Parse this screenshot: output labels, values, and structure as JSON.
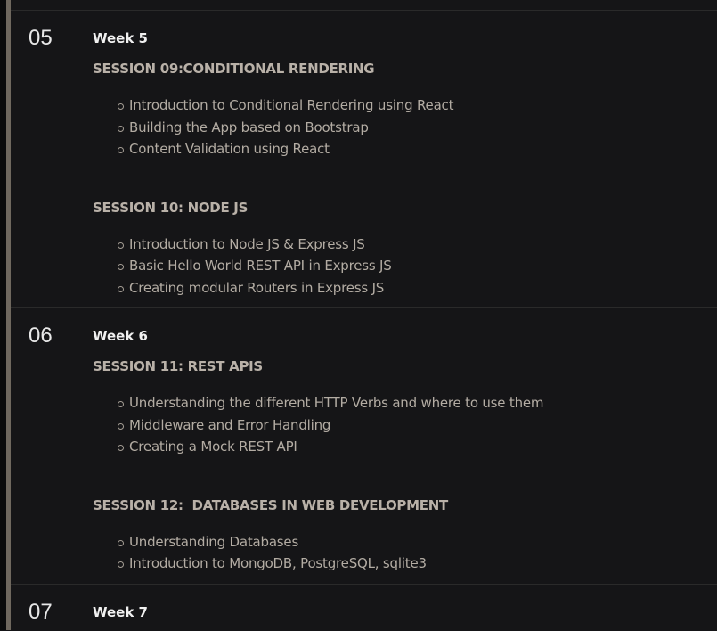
{
  "weeks": [
    {
      "number": "05",
      "title": "Week 5",
      "sessions": [
        {
          "title": "SESSION 09:CONDITIONAL RENDERING",
          "items": [
            "Introduction to Conditional Rendering using React",
            "Building the App based on Bootstrap",
            "Content Validation using React"
          ]
        },
        {
          "title": "SESSION 10: NODE JS",
          "items": [
            "Introduction to Node JS & Express JS",
            "Basic Hello World REST API in Express JS",
            "Creating modular Routers in Express JS"
          ]
        }
      ]
    },
    {
      "number": "06",
      "title": "Week 6",
      "sessions": [
        {
          "title": "SESSION 11: REST APIS",
          "items": [
            "Understanding the different HTTP Verbs and where to use them",
            "Middleware and Error Handling",
            "Creating a Mock REST API"
          ]
        },
        {
          "title": "SESSION 12:  DATABASES IN WEB DEVELOPMENT",
          "items": [
            "Understanding Databases",
            "Introduction to MongoDB, PostgreSQL, sqlite3"
          ]
        }
      ]
    },
    {
      "number": "07",
      "title": "Week 7"
    }
  ]
}
